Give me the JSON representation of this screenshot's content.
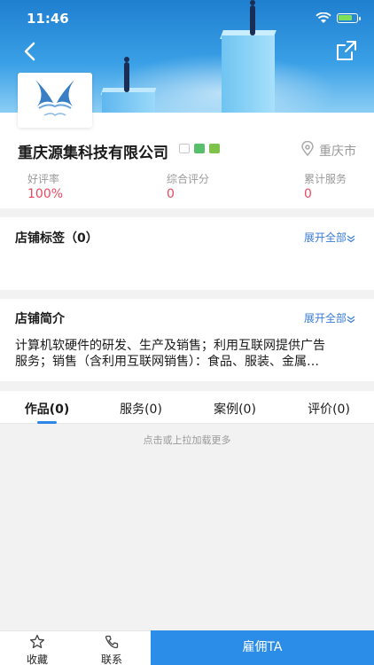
{
  "status": {
    "time": "11:46"
  },
  "company": {
    "name": "重庆源集科技有限公司",
    "location": "重庆市",
    "badge_colors": [
      "#c9c9c9",
      "#58c06a",
      "#7dc34a"
    ]
  },
  "stats": [
    {
      "label": "好评率",
      "value": "100%"
    },
    {
      "label": "综合评分",
      "value": "0"
    },
    {
      "label": "累计服务",
      "value": "0"
    }
  ],
  "tags_section": {
    "title": "店铺标签（0）",
    "expand": "展开全部"
  },
  "intro_section": {
    "title": "店铺简介",
    "expand": "展开全部",
    "line1": "计算机软硬件的研发、生产及销售；利用互联网提供广告",
    "line2": "服务；销售（含利用互联网销售）：食品、服装、金属…"
  },
  "tabs": [
    {
      "label": "作品(0)"
    },
    {
      "label": "服务(0)"
    },
    {
      "label": "案例(0)"
    },
    {
      "label": "评价(0)"
    }
  ],
  "load_more": "点击或上拉加载更多",
  "bottom": {
    "favorite": "收藏",
    "contact": "联系",
    "hire": "雇佣TA"
  },
  "colors": {
    "accent": "#2b8de8",
    "stat_value": "#e9495e",
    "link": "#3a7bd5"
  }
}
